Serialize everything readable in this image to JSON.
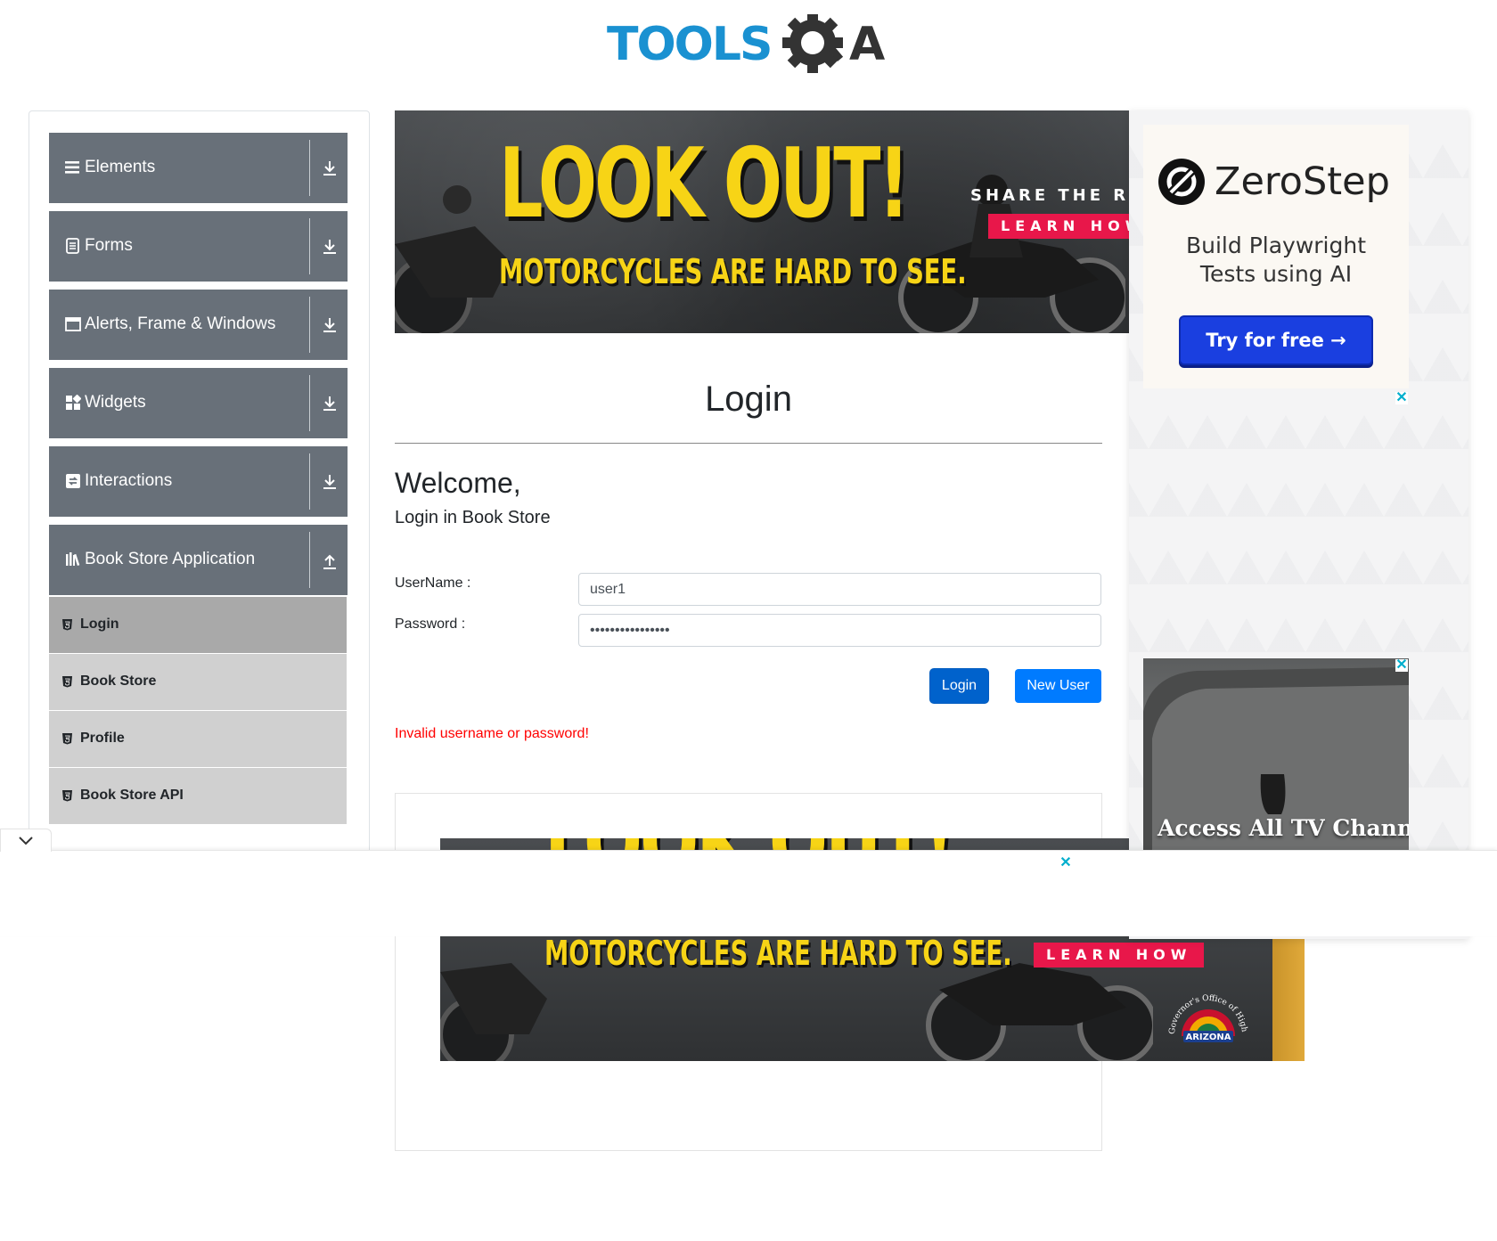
{
  "header": {
    "logo_text": "TOOLSQA"
  },
  "sidebar": {
    "groups": [
      {
        "label": "Elements",
        "icon": "menu-icon"
      },
      {
        "label": "Forms",
        "icon": "document-icon"
      },
      {
        "label": "Alerts, Frame & Windows",
        "icon": "window-icon"
      },
      {
        "label": "Widgets",
        "icon": "widgets-icon"
      },
      {
        "label": "Interactions",
        "icon": "interactions-icon"
      },
      {
        "label": "Book Store Application",
        "icon": "books-icon",
        "expanded": true
      }
    ],
    "items": [
      {
        "label": "Login",
        "active": true
      },
      {
        "label": "Book Store"
      },
      {
        "label": "Profile"
      },
      {
        "label": "Book Store API"
      }
    ]
  },
  "ads": {
    "top_banner": {
      "headline": "LOOK OUT!",
      "subline": "MOTORCYCLES ARE HARD TO SEE.",
      "share": "SHARE THE ROAD SA",
      "cta": "LEARN HOW"
    },
    "bottom_banner": {
      "headline": "LOOK OUT!",
      "subline": "MOTORCYCLES ARE HARD TO SEE.",
      "cta": "LEARN HOW",
      "seal_text": "ARIZONA",
      "seal_arc": "Governor's Office of Highway Safety"
    },
    "zerostep": {
      "brand": "ZeroStep",
      "tagline_line1": "Build Playwright",
      "tagline_line2": "Tests using AI",
      "cta": "Try for free →"
    },
    "tv": {
      "headline": "Access All TV Channels"
    },
    "close_glyph": "✕"
  },
  "main": {
    "title": "Login",
    "welcome": "Welcome,",
    "subtitle": "Login in Book Store",
    "username_label": "UserName :",
    "username_value": "user1",
    "password_label": "Password :",
    "password_value": "••••••••••••••••",
    "login_button": "Login",
    "new_user_button": "New User",
    "error": "Invalid username or password!"
  },
  "colors": {
    "accent": "#007bff",
    "sidebar_header": "#687079",
    "error": "#ff0000",
    "logo_blue": "#1a91d1",
    "logo_dark": "#333333"
  }
}
